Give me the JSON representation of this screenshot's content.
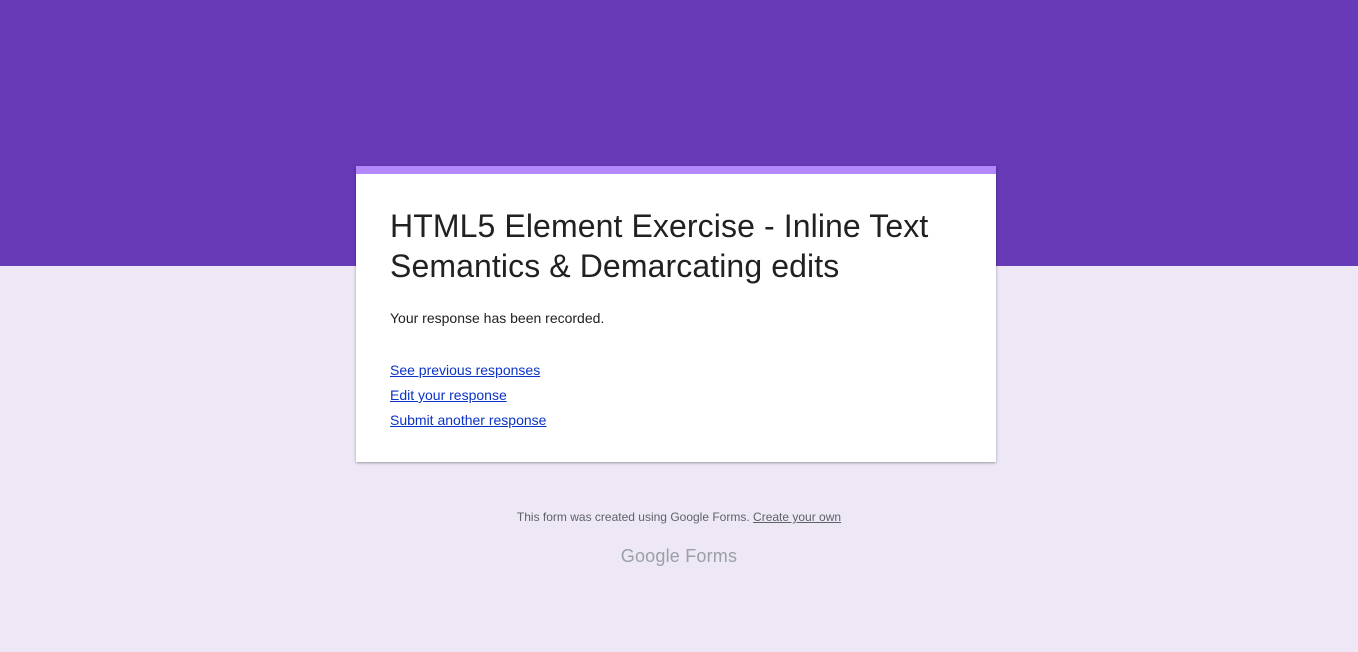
{
  "colors": {
    "banner": "#673ab7",
    "accent_bar": "#b388ff",
    "background": "#ede7f6",
    "link": "#0b33c6"
  },
  "form": {
    "title": "HTML5 Element Exercise - Inline Text Semantics & Demarcating edits",
    "confirmation": "Your response has been recorded.",
    "links": {
      "see_previous": "See previous responses",
      "edit_response": "Edit your response",
      "submit_another": "Submit another response"
    }
  },
  "footer": {
    "notice": "This form was created using Google Forms.",
    "create_link": "Create your own",
    "logo_text": "Google Forms"
  }
}
